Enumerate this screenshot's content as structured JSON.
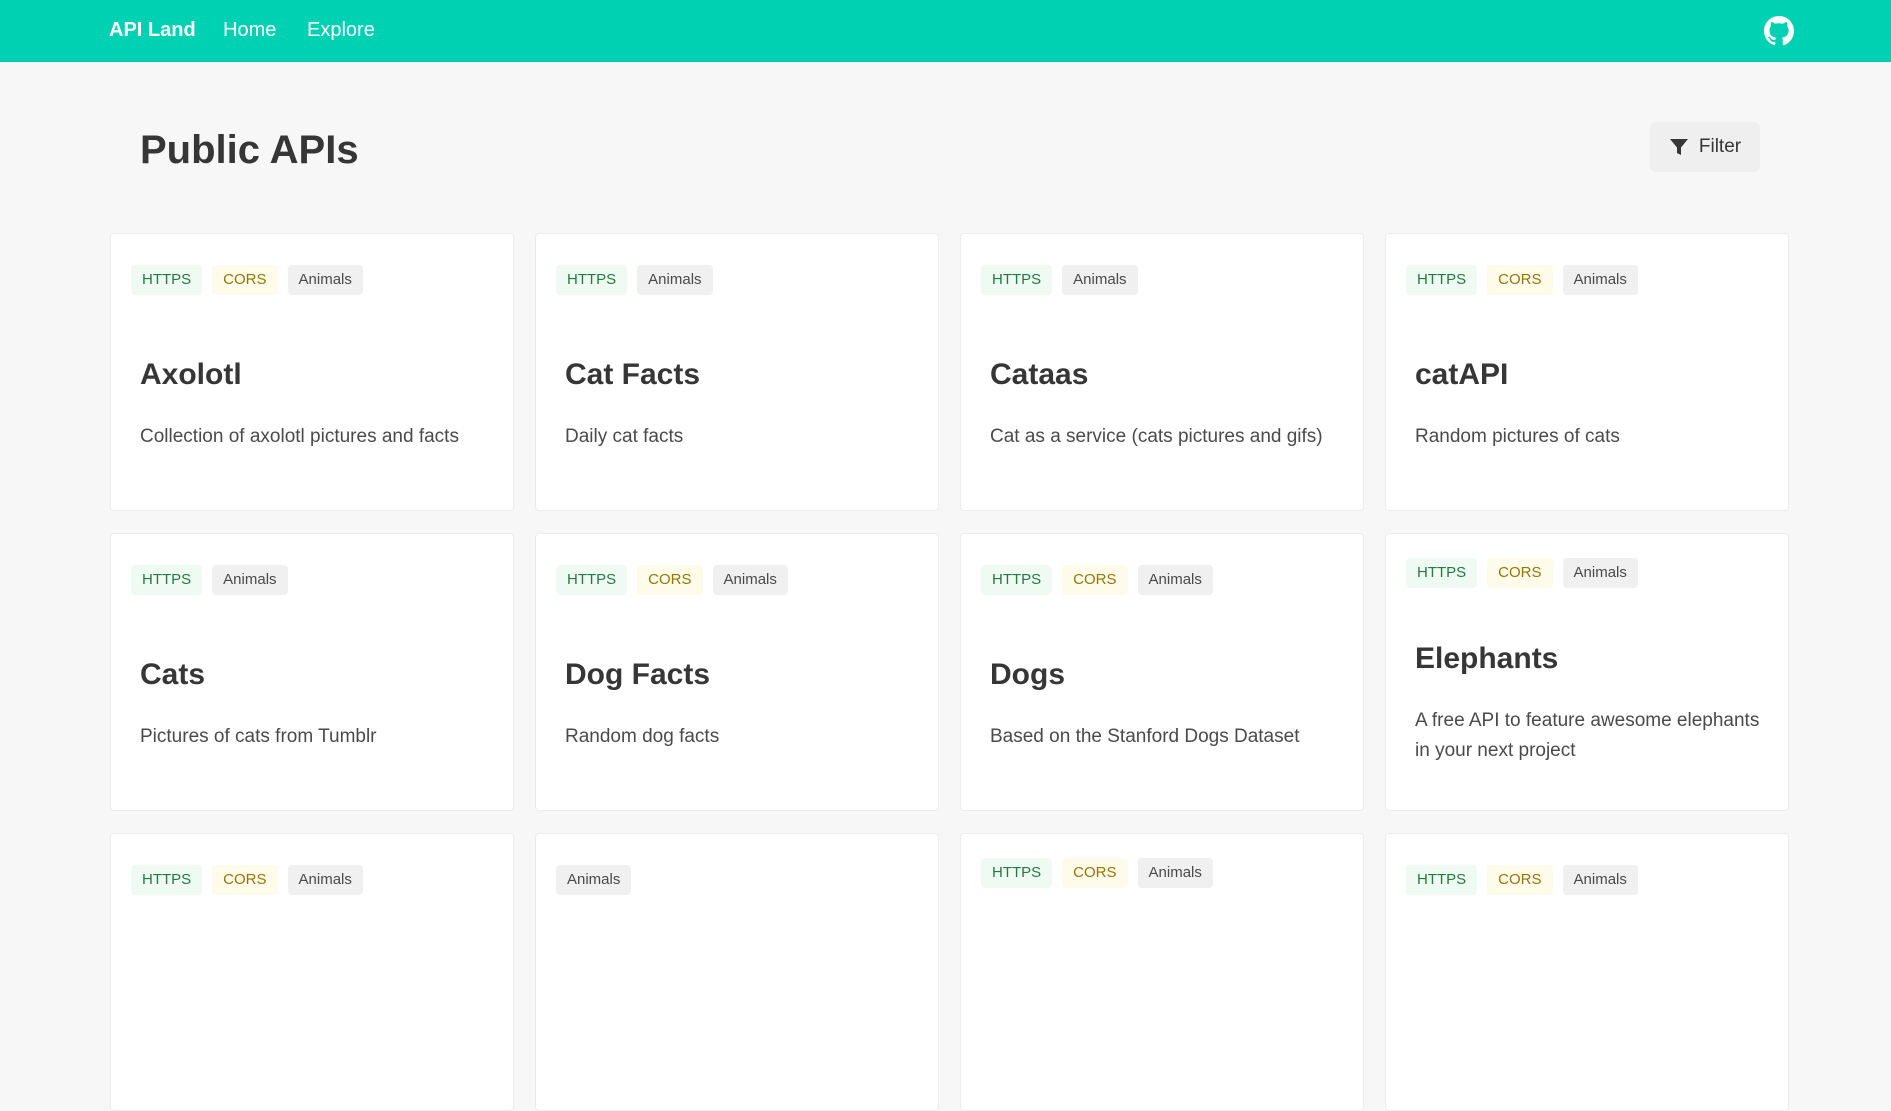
{
  "nav": {
    "brand": "API Land",
    "home": "Home",
    "explore": "Explore"
  },
  "page": {
    "title": "Public APIs",
    "filter_label": "Filter"
  },
  "cards": [
    {
      "title": "Axolotl",
      "description": "Collection of axolotl pictures and facts",
      "tags": {
        "https": "HTTPS",
        "cors": "CORS",
        "category": "Animals"
      }
    },
    {
      "title": "Cat Facts",
      "description": "Daily cat facts",
      "tags": {
        "https": "HTTPS",
        "category": "Animals"
      }
    },
    {
      "title": "Cataas",
      "description": "Cat as a service (cats pictures and gifs)",
      "tags": {
        "https": "HTTPS",
        "category": "Animals"
      }
    },
    {
      "title": "catAPI",
      "description": "Random pictures of cats",
      "tags": {
        "https": "HTTPS",
        "cors": "CORS",
        "category": "Animals"
      }
    },
    {
      "title": "Cats",
      "description": "Pictures of cats from Tumblr",
      "tags": {
        "https": "HTTPS",
        "category": "Animals"
      }
    },
    {
      "title": "Dog Facts",
      "description": "Random dog facts",
      "tags": {
        "https": "HTTPS",
        "cors": "CORS",
        "category": "Animals"
      }
    },
    {
      "title": "Dogs",
      "description": "Based on the Stanford Dogs Dataset",
      "tags": {
        "https": "HTTPS",
        "cors": "CORS",
        "category": "Animals"
      }
    },
    {
      "title": "Elephants",
      "description": "A free API to feature awesome elephants in your next project",
      "tags": {
        "https": "HTTPS",
        "cors": "CORS",
        "category": "Animals"
      }
    },
    {
      "tags": {
        "https": "HTTPS",
        "cors": "CORS",
        "category": "Animals"
      }
    },
    {
      "tags": {
        "category": "Animals"
      }
    },
    {
      "tags": {
        "https": "HTTPS",
        "cors": "CORS",
        "category": "Animals"
      }
    },
    {
      "tags": {
        "https": "HTTPS",
        "cors": "CORS",
        "category": "Animals"
      }
    }
  ],
  "colors": {
    "navbar": "#00d1b2",
    "https_tag_bg": "#effaf3",
    "https_tag_text": "#257942",
    "cors_tag_bg": "#fffbeb",
    "cors_tag_text": "#947600",
    "category_tag_bg": "#f0f0f0"
  },
  "icons": {
    "github": "github-icon",
    "filter": "filter-icon"
  }
}
